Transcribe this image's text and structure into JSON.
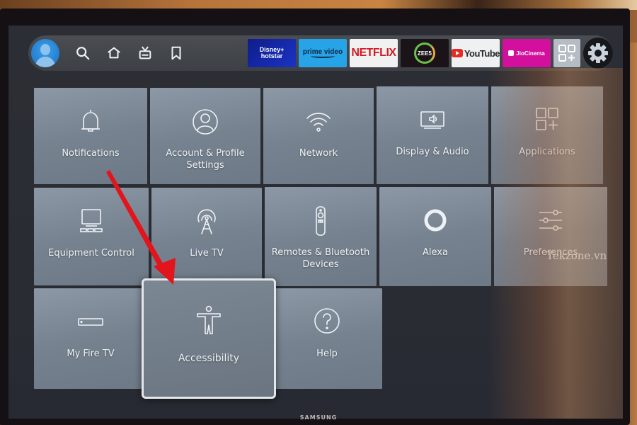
{
  "nav": {
    "icons": [
      "profile-avatar",
      "search-icon",
      "home-icon",
      "live-tv-icon",
      "bookmark-icon"
    ],
    "apps": [
      {
        "name": "hotstar",
        "line1": "Disney+",
        "line2": "hotstar",
        "color": "#1b33c4"
      },
      {
        "name": "prime-video",
        "label": "prime video",
        "color": "#27a4e8"
      },
      {
        "name": "netflix",
        "label": "NETFLIX",
        "color": "#cf1b24"
      },
      {
        "name": "zee5",
        "label": "ZEE5",
        "color": "#1a1418"
      },
      {
        "name": "youtube",
        "label": "YouTube",
        "color": "#e52d27"
      },
      {
        "name": "jiocinema",
        "label": "JioCinema",
        "color": "#d3109d"
      }
    ],
    "all_apps_icon": "apps-grid-icon",
    "settings_icon": "gear-icon"
  },
  "settings": {
    "tiles": [
      {
        "label": "Notifications",
        "icon": "bell-icon"
      },
      {
        "label": "Account & Profile Settings",
        "icon": "account-icon"
      },
      {
        "label": "Network",
        "icon": "wifi-icon"
      },
      {
        "label": "Display & Audio",
        "icon": "display-audio-icon"
      },
      {
        "label": "Applications",
        "icon": "applications-icon"
      },
      {
        "label": "Equipment Control",
        "icon": "equipment-icon"
      },
      {
        "label": "Live TV",
        "icon": "antenna-icon"
      },
      {
        "label": "Remotes & Bluetooth Devices",
        "icon": "remote-icon"
      },
      {
        "label": "Alexa",
        "icon": "alexa-icon"
      },
      {
        "label": "Preferences",
        "icon": "sliders-icon"
      },
      {
        "label": "My Fire TV",
        "icon": "fire-tv-device-icon"
      },
      {
        "label": "Accessibility",
        "icon": "accessibility-icon",
        "focused": true
      },
      {
        "label": "Help",
        "icon": "help-icon"
      }
    ]
  },
  "tv_brand": "SAMSUNG",
  "watermark": "Tekzone.vn",
  "annotation": {
    "type": "arrow",
    "color": "#e3141b",
    "points_to": "Accessibility"
  }
}
